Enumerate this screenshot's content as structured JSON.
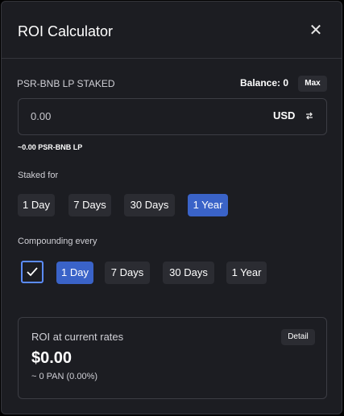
{
  "modal": {
    "title": "ROI Calculator",
    "close_icon": "close-icon"
  },
  "stake": {
    "label": "PSR-BNB LP STAKED",
    "balance": "Balance: 0",
    "max_label": "Max",
    "input_value": "0.00",
    "currency": "USD",
    "swap_icon": "swap-icon",
    "converted": "~0.00 PSR-BNB LP"
  },
  "staked_for": {
    "label": "Staked for",
    "options": [
      "1 Day",
      "7 Days",
      "30 Days",
      "1 Year"
    ],
    "selected": "1 Year"
  },
  "compounding": {
    "label": "Compounding every",
    "checked": true,
    "options": [
      "1 Day",
      "7 Days",
      "30 Days",
      "1 Year"
    ],
    "selected": "1 Day"
  },
  "roi": {
    "label": "ROI at current rates",
    "detail_label": "Detail",
    "value": "$0.00",
    "sub": "~ 0 PAN (0.00%)"
  },
  "colors": {
    "accent": "#3a63c8",
    "checkbox_border": "#5b8cff",
    "background": "#1c1d22",
    "pill": "#2b2c32"
  }
}
